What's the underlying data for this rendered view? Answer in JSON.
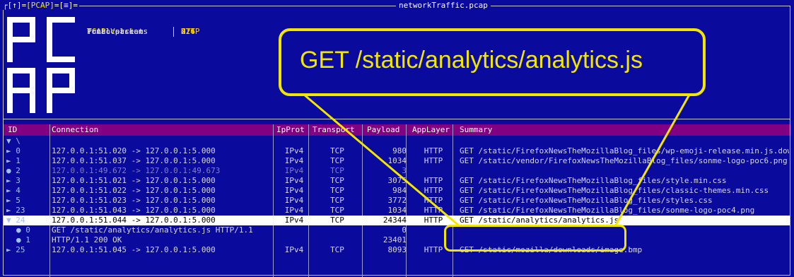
{
  "window": {
    "title": "networkTraffic.pcap",
    "menu_left": "┌[↑]=",
    "menu_accent": "[PCAP]",
    "menu_right": "=[≡]="
  },
  "logo": {
    "text": "PCAP"
  },
  "info": [
    {
      "key": "PCAP Version",
      "value": "2.4"
    },
    {
      "key": "Total packets",
      "value": "426"
    },
    {
      "key": "Total streams",
      "value": "27"
    },
    {
      "key": "Protocols",
      "value": "HTTP"
    }
  ],
  "table": {
    "headers": {
      "id": "ID",
      "connection": "Connection",
      "ipprot": "IpProt",
      "transport": "Transport",
      "payload": "Payload",
      "applayer": "AppLayer",
      "summary": "Summary"
    },
    "root": "▼ \\",
    "rows": [
      {
        "id": "► 0",
        "conn": "127.0.0.1:51.020 -> 127.0.0.1:5.000",
        "ip": "IPv4",
        "tr": "TCP",
        "pl": "980",
        "app": "HTTP",
        "sum": "GET /static/FirefoxNewsTheMozillaBlog_files/wp-emoji-release.min.js.download"
      },
      {
        "id": "► 1",
        "conn": "127.0.0.1:51.037 -> 127.0.0.1:5.000",
        "ip": "IPv4",
        "tr": "TCP",
        "pl": "1034",
        "app": "HTTP",
        "sum": "GET /static/vendor/FirefoxNewsTheMozillaBlog_files/sonme-logo-poc6.png"
      },
      {
        "id": "● 2",
        "conn": "127.0.0.1:49.672 -> 127.0.0.1:49.673",
        "ip": "IPv4",
        "tr": "TCP",
        "pl": "3",
        "app": "",
        "sum": "",
        "dim": true
      },
      {
        "id": "► 3",
        "conn": "127.0.0.1:51.021 -> 127.0.0.1:5.000",
        "ip": "IPv4",
        "tr": "TCP",
        "pl": "3075",
        "app": "HTTP",
        "sum": "GET /static/FirefoxNewsTheMozillaBlog_files/style.min.css"
      },
      {
        "id": "► 4",
        "conn": "127.0.0.1:51.022 -> 127.0.0.1:5.000",
        "ip": "IPv4",
        "tr": "TCP",
        "pl": "984",
        "app": "HTTP",
        "sum": "GET /static/FirefoxNewsTheMozillaBlog_files/classic-themes.min.css"
      },
      {
        "id": "► 5",
        "conn": "127.0.0.1:51.023 -> 127.0.0.1:5.000",
        "ip": "IPv4",
        "tr": "TCP",
        "pl": "3772",
        "app": "HTTP",
        "sum": "GET /static/FirefoxNewsTheMozillaBlog_files/styles.css"
      },
      {
        "id": "► 23",
        "conn": "127.0.0.1:51.043 -> 127.0.0.1:5.000",
        "ip": "IPv4",
        "tr": "TCP",
        "pl": "1034",
        "app": "HTTP",
        "sum": "GET /static/FirefoxNewsTheMozillaBlog_files/sonme-logo-poc4.png"
      },
      {
        "id": "▼ 24",
        "conn": "127.0.0.1:51.044 -> 127.0.0.1:5.000",
        "ip": "IPv4",
        "tr": "TCP",
        "pl": "24344",
        "app": "HTTP",
        "sum": "GET /static/analytics/analytics.js",
        "sel": true
      },
      {
        "id": "● 0",
        "conn": "GET /static/analytics/analytics.js HTTP/1.1",
        "ip": "",
        "tr": "",
        "pl": "0",
        "app": "",
        "sum": "",
        "child": true
      },
      {
        "id": "● 1",
        "conn": "HTTP/1.1 200 OK",
        "ip": "",
        "tr": "",
        "pl": "23401",
        "app": "",
        "sum": "",
        "child": true
      },
      {
        "id": "► 25",
        "conn": "127.0.0.1:51.045 -> 127.0.0.1:5.000",
        "ip": "IPv4",
        "tr": "TCP",
        "pl": "8093",
        "app": "HTTP",
        "sum": "GET /static/mozilla/downloads/image.bmp"
      }
    ]
  },
  "callout": {
    "text": "GET /static/analytics/analytics.js"
  },
  "colors": {
    "background": "#0a0a9c",
    "header": "#820082",
    "highlight": "#f2e600",
    "selected_row": "#ffffff"
  }
}
